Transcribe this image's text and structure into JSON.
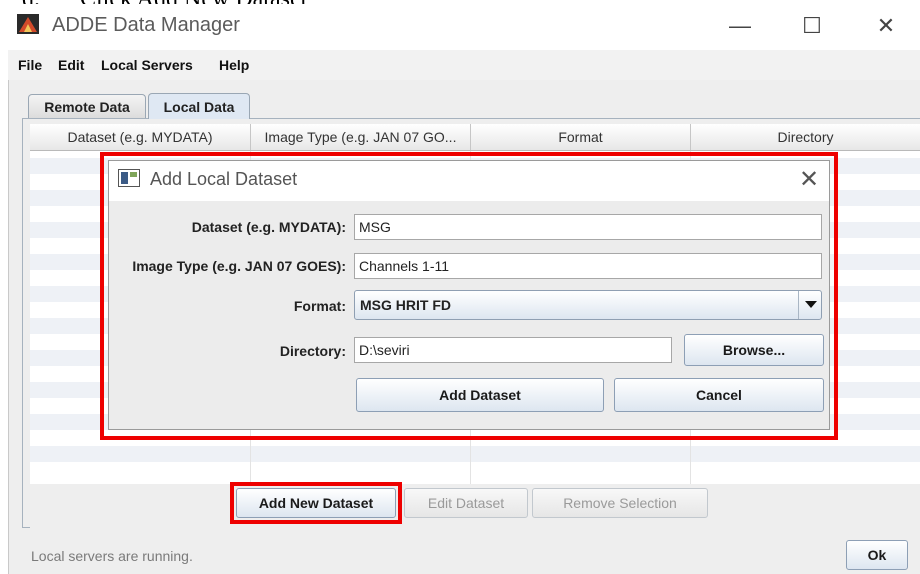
{
  "caption": {
    "number": "d.",
    "text": "Click Add New Dataset"
  },
  "window": {
    "title": "ADDE Data Manager",
    "controls": [
      "—",
      "☐",
      "✕"
    ],
    "menu": [
      "File",
      "Edit",
      "Local Servers",
      "Help"
    ]
  },
  "tabs": [
    {
      "label": "Remote Data",
      "active": false
    },
    {
      "label": "Local Data",
      "active": true
    }
  ],
  "table": {
    "columns": [
      "Dataset (e.g. MYDATA)",
      "Image Type (e.g. JAN 07 GO...",
      "Format",
      "Directory"
    ],
    "rows": []
  },
  "buttons": {
    "add_new": "Add New Dataset",
    "edit": "Edit Dataset",
    "remove": "Remove Selection",
    "ok": "Ok"
  },
  "status": "Local servers are running.",
  "dialog": {
    "title": "Add Local Dataset",
    "dataset_label": "Dataset (e.g. MYDATA):",
    "dataset_value": "MSG",
    "imagetype_label": "Image Type (e.g. JAN 07 GOES):",
    "imagetype_value": "Channels 1-11",
    "format_label": "Format:",
    "format_value": "MSG HRIT FD",
    "directory_label": "Directory:",
    "directory_value": "D:\\seviri",
    "browse_label": "Browse...",
    "add_label": "Add Dataset",
    "cancel_label": "Cancel"
  },
  "colors": {
    "highlight": "#ee0000",
    "active_tab": "#dfe8f3",
    "row_stripe": "#eef1f6"
  }
}
